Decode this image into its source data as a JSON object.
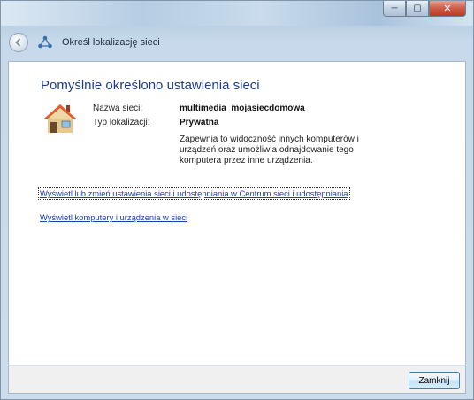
{
  "window": {
    "nav_title": "Określ lokalizację sieci"
  },
  "main": {
    "heading": "Pomyślnie określono ustawienia sieci",
    "network_name_label": "Nazwa sieci:",
    "network_name_value": "multimedia_mojasiecdomowa",
    "location_type_label": "Typ lokalizacji:",
    "location_type_value": "Prywatna",
    "description": "Zapewnia to widoczność innych komputerów i urządzeń oraz umożliwia odnajdowanie tego komputera przez inne urządzenia.",
    "link_network_center": "Wyświetl lub zmień ustawienia sieci i udostępniania w Centrum sieci i udostępniania",
    "link_view_computers": "Wyświetl komputery i urządzenia w sieci"
  },
  "footer": {
    "close_label": "Zamknij"
  },
  "icons": {
    "back": "back-arrow-icon",
    "network": "network-icon",
    "house": "home-network-icon",
    "minimize": "minimize-icon",
    "maximize": "maximize-icon",
    "close": "close-icon"
  },
  "colors": {
    "heading": "#1f3f8a",
    "link": "#1a3fb3",
    "close_window": "#cf5b45"
  }
}
